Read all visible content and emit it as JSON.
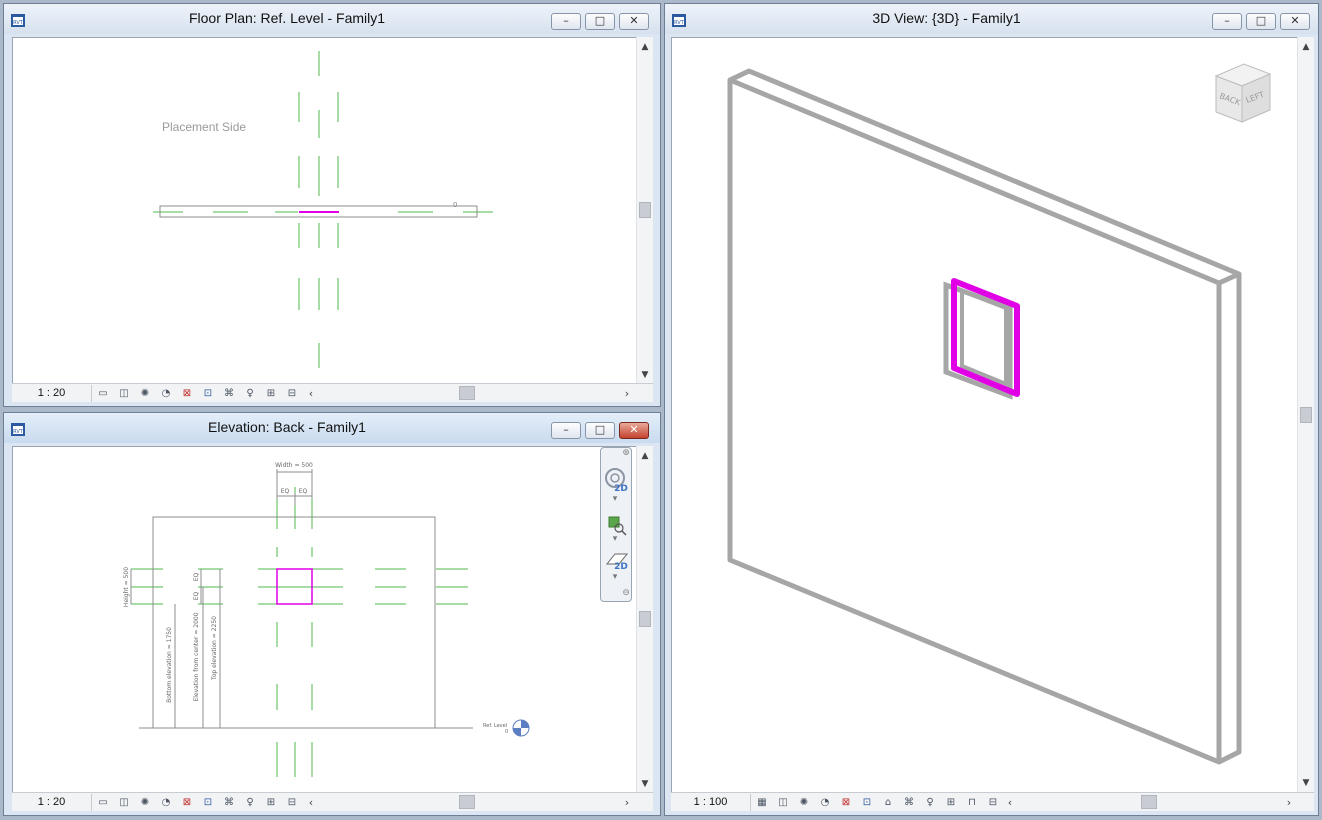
{
  "windows": {
    "floor_plan": {
      "title": "Floor Plan: Ref. Level - Family1",
      "scale": "1 : 20",
      "annotation": "Placement Side"
    },
    "elevation": {
      "title": "Elevation: Back - Family1",
      "scale": "1 : 20",
      "dims": {
        "width": "Width = 500",
        "eq1": "EQ",
        "eq2": "EQ",
        "height": "Height = 500",
        "eq3": "EQ",
        "eq4": "EQ",
        "bottom_elev": "Bottom elevation = 1750",
        "center_elev": "Elevation from center = 2000",
        "top_elev": "Top elevation = 2250",
        "level": "Ref. Level",
        "level_value": "0"
      },
      "nav": {
        "zoom_label": "2D",
        "plane_label": "2D"
      }
    },
    "view3d": {
      "title": "3D View: {3D} - Family1",
      "scale": "1 : 100",
      "viewcube": {
        "face_back": "BACK",
        "face_left": "LEFT"
      }
    }
  },
  "window_buttons": {
    "minimize": "–",
    "maximize": "□",
    "close": "✕"
  },
  "colors": {
    "selection": "#e100e6",
    "ref_plane": "#4fb84f",
    "model": "#a6a6a6"
  }
}
